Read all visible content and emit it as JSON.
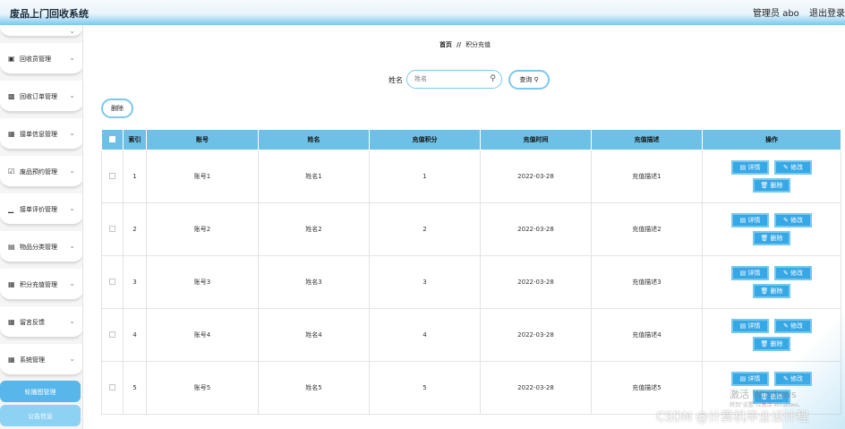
{
  "header": {
    "title": "废品上门回收系统",
    "user_label": "管理员 abo",
    "logout_label": "退出登录"
  },
  "sidebar": {
    "items": [
      {
        "label": "回收员管理",
        "icon": "briefcase-icon"
      },
      {
        "label": "回收订单管理",
        "icon": "video-icon"
      },
      {
        "label": "接单信息管理",
        "icon": "grid-icon"
      },
      {
        "label": "废品预约管理",
        "icon": "checkbox-icon"
      },
      {
        "label": "接单评价管理",
        "icon": "bar-chart-icon"
      },
      {
        "label": "物品分类管理",
        "icon": "clipboard-icon"
      },
      {
        "label": "积分充值管理",
        "icon": "grid-icon"
      },
      {
        "label": "留言反馈",
        "icon": "grid-icon"
      },
      {
        "label": "系统管理",
        "icon": "grid-icon"
      }
    ],
    "sub_items": [
      {
        "label": "轮播图管理"
      },
      {
        "label": "公告信息"
      }
    ]
  },
  "breadcrumb": {
    "home": "首页",
    "separator": "//",
    "current": "积分充值"
  },
  "search": {
    "label": "姓名",
    "placeholder": "姓名",
    "query_label": "查询"
  },
  "toolbar": {
    "delete_label": "删除"
  },
  "table": {
    "columns": [
      "索引",
      "账号",
      "姓名",
      "充值积分",
      "充值时间",
      "充值描述",
      "操作"
    ],
    "rows": [
      {
        "index": "1",
        "account": "账号1",
        "name": "姓名1",
        "points": "1",
        "time": "2022-03-28",
        "desc": "充值描述1"
      },
      {
        "index": "2",
        "account": "账号2",
        "name": "姓名2",
        "points": "2",
        "time": "2022-03-28",
        "desc": "充值描述2"
      },
      {
        "index": "3",
        "account": "账号3",
        "name": "姓名3",
        "points": "3",
        "time": "2022-03-28",
        "desc": "充值描述3"
      },
      {
        "index": "4",
        "account": "账号4",
        "name": "姓名4",
        "points": "4",
        "time": "2022-03-28",
        "desc": "充值描述4"
      },
      {
        "index": "5",
        "account": "账号5",
        "name": "姓名5",
        "points": "5",
        "time": "2022-03-28",
        "desc": "充值描述5"
      }
    ],
    "actions": {
      "detail": "详情",
      "edit": "修改",
      "delete": "删除"
    }
  },
  "overlay": {
    "activate_windows": "激活 Windows",
    "activate_windows_sub": "转到\"设置\"以激活 Windows。",
    "csdn_watermark": "CSDN @计算机毕业设计程"
  },
  "colors": {
    "accent": "#6ec1e6",
    "button_fill": "#37a8e6",
    "sub_menu": "#8dd1f3"
  }
}
